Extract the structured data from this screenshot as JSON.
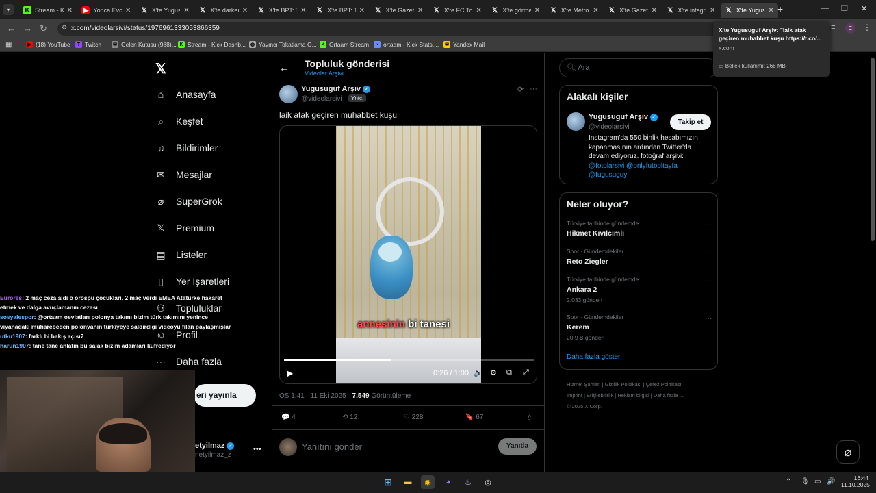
{
  "browser": {
    "tabs": [
      {
        "label": "Stream - Kick",
        "favicon": "kick-icon",
        "active": false
      },
      {
        "label": "Yonca Evcimen",
        "favicon": "youtube-icon",
        "active": false
      },
      {
        "label": "X'te Yugusuguf",
        "favicon": "x-icon",
        "active": false
      },
      {
        "label": "X'te darkeremo",
        "favicon": "x-icon",
        "active": false
      },
      {
        "label": "X'te BPT: Türk",
        "favicon": "x-icon",
        "active": false
      },
      {
        "label": "X'te BPT: Türk",
        "favicon": "x-icon",
        "active": false
      },
      {
        "label": "X'te Gazete",
        "favicon": "x-icon",
        "active": false
      },
      {
        "label": "X'te FC Torino",
        "favicon": "x-icon",
        "active": false
      },
      {
        "label": "X'te görmeni",
        "favicon": "x-icon",
        "active": false
      },
      {
        "label": "X'te Metropoll",
        "favicon": "x-icon",
        "active": false
      },
      {
        "label": "X'te Gazete",
        "favicon": "x-icon",
        "active": false
      },
      {
        "label": "X'te integral",
        "favicon": "x-icon",
        "active": false
      },
      {
        "label": "X'te Yugusuguf",
        "favicon": "x-icon",
        "active": true
      }
    ],
    "url": "x.com/videolarsivi/status/1976961333053866359",
    "bookmarks": [
      {
        "label": "(18) YouTube",
        "icon": "youtube-icon",
        "color": "#ff0000"
      },
      {
        "label": "Twitch",
        "icon": "twitch-icon",
        "color": "#9146ff"
      },
      {
        "label": "Gelen Kutusu (988)...",
        "icon": "mail-icon",
        "color": "#888888"
      },
      {
        "label": "Stream - Kick Dashb...",
        "icon": "kick-icon",
        "color": "#53fc18"
      },
      {
        "label": "Yayıncı Tokatlama O...",
        "icon": "globe-icon",
        "color": "#aaaaaa"
      },
      {
        "label": "Ortaam Stream",
        "icon": "kick-icon",
        "color": "#53fc18"
      },
      {
        "label": "ortaam - Kick Stats,...",
        "icon": "stats-icon",
        "color": "#6a8cff"
      },
      {
        "label": "Yandex Mail",
        "icon": "mail-icon",
        "color": "#ffcc00"
      }
    ],
    "tooltip": {
      "title": "X'te Yugusuguf Arşiv: \"laik atak geçiren muhabbet kuşu https://t.co/...",
      "domain": "x.com",
      "memory": "Bellek kullanımı: 268 MB"
    }
  },
  "sidebar": {
    "items": [
      {
        "label": "Anasayfa",
        "icon": "home-icon"
      },
      {
        "label": "Keşfet",
        "icon": "search-icon"
      },
      {
        "label": "Bildirimler",
        "icon": "bell-icon"
      },
      {
        "label": "Mesajlar",
        "icon": "mail-icon"
      },
      {
        "label": "SuperGrok",
        "icon": "grok-icon"
      },
      {
        "label": "Premium",
        "icon": "x-icon"
      },
      {
        "label": "Listeler",
        "icon": "list-icon"
      },
      {
        "label": "Yer İşaretleri",
        "icon": "bookmark-icon"
      },
      {
        "label": "Topluluklar",
        "icon": "people-icon"
      },
      {
        "label": "Profil",
        "icon": "user-icon"
      },
      {
        "label": "Daha fazla",
        "icon": "more-icon"
      }
    ],
    "post_button": "eri yayınla",
    "account": {
      "name": "etyilmaz",
      "handle": "netyilmaz_z"
    }
  },
  "post": {
    "header_title": "Topluluk gönderisi",
    "header_subtitle": "Videolar Arşivi",
    "author_name": "Yugusuguf Arşiv",
    "author_handle": "@videolarsivi",
    "badge": "Yntc.",
    "text": "laik atak geçiren muhabbet kuşu",
    "video": {
      "caption_a": "annesinin",
      "caption_b": " bi tanesi",
      "time": "0:26 / 1:00",
      "progress": 0.43
    },
    "meta_time": "ÖS 1:41 · 11 Eki 2025 · ",
    "views": "7.549",
    "views_label": " Görüntüleme",
    "replies": "4",
    "reposts": "12",
    "likes": "228",
    "bookmarks": "67",
    "reply_placeholder": "Yanıtını gönder",
    "reply_button": "Yanıtla"
  },
  "right": {
    "search_placeholder": "Ara",
    "relevant_title": "Alakalı kişiler",
    "person": {
      "name": "Yugusuguf Arşiv",
      "handle": "@videolarsivi",
      "follow": "Takip et",
      "bio_line1": "Instagram'da 550 binlik hesabımızın",
      "bio_line2": "kapanmasının ardından Twitter'da",
      "bio_line3": "devam ediyoruz. fotoğraf arşivi:",
      "link1": "@fotolarsivi",
      "link2": "@onlyfutboltayfa",
      "link3": "@fugusuguy"
    },
    "trends_title": "Neler oluyor?",
    "trends": [
      {
        "context": "Türkiye tarihinde gündemde",
        "name": "Hikmet Kıvılcımlı",
        "count": ""
      },
      {
        "context": "Spor · Gündemdekiler",
        "name": "Reto Ziegler",
        "count": ""
      },
      {
        "context": "Türkiye tarihinde gündemde",
        "name": "Ankara 2",
        "count": "2.033 gönderi"
      },
      {
        "context": "Spor · Gündemdekiler",
        "name": "Kerem",
        "count": "20,9 B gönderi"
      }
    ],
    "show_more": "Daha fazla göster",
    "footer_line1": [
      "Hizmet Şartları",
      "Gizlilik Politikası",
      "Çerez Politikası"
    ],
    "footer_line2": [
      "Imprint",
      "Erişilebilirlik",
      "Reklam bilgisi",
      "Daha fazla ..."
    ],
    "copyright": "© 2025 X Corp."
  },
  "chat": [
    {
      "user": "Eurores",
      "color": "#b36bff",
      "msg": ": 2 maç ceza aldı o orospu çocukları. 2 maç verdi EMEA Atatürke hakaret etmek ve dalga avuçlamanın cezası"
    },
    {
      "user": "sosyalespor",
      "color": "#6fb8ff",
      "msg": ": @ortaam oevlatları polonya takımı bizim türk takımını yenince viyanadaki muharebeden polonyanın türkiyeye saldırdığı videoyu filan paylaşmışlar"
    },
    {
      "user": "utku1907",
      "color": "#6fb8ff",
      "msg": ": farklı bi bakış açısı7"
    },
    {
      "user": "harun1907",
      "color": "#6fb8ff",
      "msg": ": tane tane anlatın bu salak bizim adamları küfrediyor"
    }
  ],
  "taskbar": {
    "time": "16:44",
    "date": "11.10.2025"
  }
}
